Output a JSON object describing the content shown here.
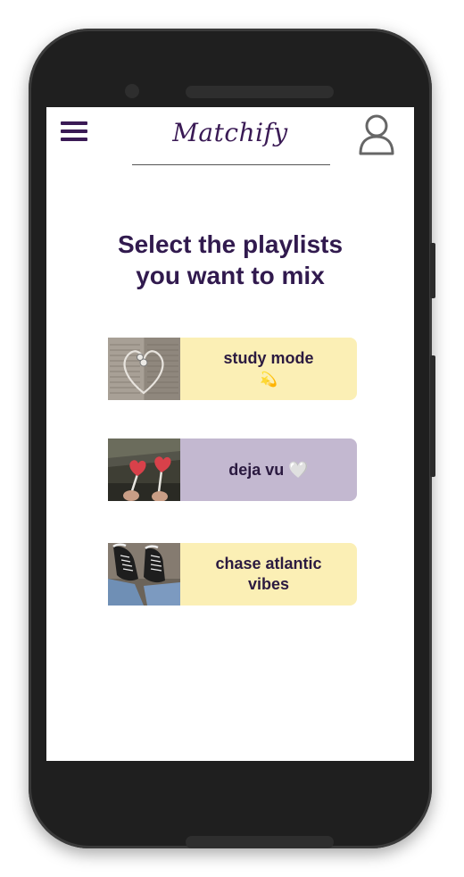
{
  "app": {
    "title": "Matchify"
  },
  "header": {
    "menu_icon": "hamburger-menu-icon",
    "profile_icon": "user-profile-icon"
  },
  "main": {
    "heading_line1": "Select the playlists",
    "heading_line2": "you want to mix"
  },
  "playlists": [
    {
      "name": "study mode",
      "emoji": "💫",
      "bg_color": "#fbefb5",
      "thumb_icon": "headphones-heart-on-book-photo"
    },
    {
      "name": "deja vu",
      "emoji": "🤍",
      "bg_color": "#c3b8d0",
      "thumb_icon": "heart-lollipops-photo"
    },
    {
      "name_line1": "chase atlantic",
      "name_line2": "vibes",
      "bg_color": "#fbefb5",
      "thumb_icon": "converse-sneakers-photo"
    }
  ],
  "colors": {
    "accent": "#3a1a55",
    "heading": "#311a4e",
    "phone_frame": "#1f1f1f"
  }
}
